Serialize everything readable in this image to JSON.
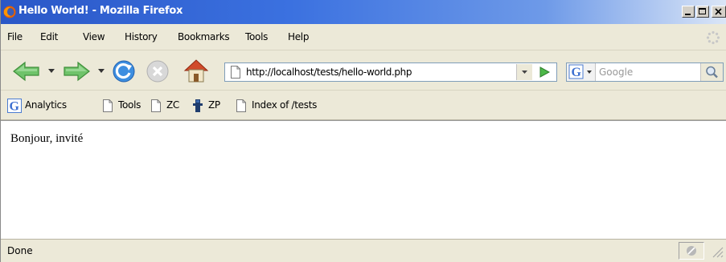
{
  "window": {
    "title": "Hello World! - Mozilla Firefox",
    "icon": "firefox-icon",
    "controls": [
      "minimize-icon",
      "maximize-icon",
      "close-icon"
    ]
  },
  "menu": {
    "items": [
      {
        "label": "File"
      },
      {
        "label": "Edit"
      },
      {
        "label": "View"
      },
      {
        "label": "History"
      },
      {
        "label": "Bookmarks"
      },
      {
        "label": "Tools"
      },
      {
        "label": "Help"
      }
    ]
  },
  "navigation": {
    "buttons": [
      "back-arrow-icon",
      "forward-arrow-icon",
      "reload-icon",
      "stop-icon",
      "home-icon"
    ],
    "url": "http://localhost/tests/hello-world.php",
    "search_placeholder": "Google",
    "search_engine_icon": "google-icon"
  },
  "bookmarks": {
    "items": [
      {
        "label": "Analytics",
        "icon": "google-icon"
      },
      {
        "label": "Tools",
        "icon": "page-icon"
      },
      {
        "label": "ZC",
        "icon": "page-icon"
      },
      {
        "label": "ZP",
        "icon": "zp-icon"
      },
      {
        "label": "Index of /tests",
        "icon": "page-icon"
      }
    ]
  },
  "content": {
    "text": "Bonjour, invité"
  },
  "status": {
    "text": "Done"
  },
  "colors": {
    "titlebar_start": "#2a57c7",
    "titlebar_end": "#dbe6f7",
    "chrome": "#ece9d8",
    "nav_green": "#4cb848"
  }
}
